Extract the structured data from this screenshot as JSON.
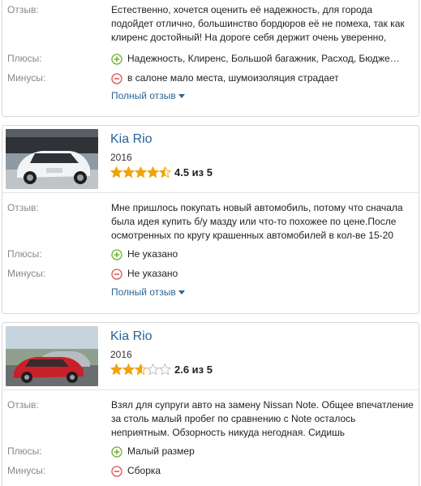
{
  "labels": {
    "review": "Отзыв:",
    "pros": "Плюсы:",
    "cons": "Минусы:",
    "more": "Полный отзыв"
  },
  "cards": [
    {
      "review": "Естественно, хочется оценить её надежность, для города подойдет отлично, большинство бордюров её не помеха, так как клиренс достойный! На дороге себя держит очень уверенно,",
      "pros": "Надежность, Клиренс, Большой багажник, Расход, Бюдже…",
      "cons": "в салоне мало места, шумоизоляция страдает"
    },
    {
      "title": "Kia Rio",
      "year": "2016",
      "rating": 4.5,
      "rating_text": "4.5 из 5",
      "photo_icon": "car-photo-white-hatchback",
      "review": "Мне пришлось покупать новый автомобиль, потому что сначала была идея купить б/у мазду или что-то похожее по цене.После осмотренных по кругу крашенных автомобилей в кол-ве 15-20",
      "pros": "Не указано",
      "cons": "Не указано"
    },
    {
      "title": "Kia Rio",
      "year": "2016",
      "rating": 2.6,
      "rating_text": "2.6 из 5",
      "photo_icon": "car-photo-red-sedan",
      "review": "Взял для супруги авто на замену Nissan Note. Общее впечатление за столь малый пробег по сравнению с Note осталось неприятным. Обзорность никуда негодная. Сидишь",
      "pros": "Малый размер",
      "cons": "Сборка"
    }
  ],
  "colors": {
    "link": "#2a6496",
    "star": "#f0a30a",
    "plus": "#6cb22a",
    "minus": "#d9534f",
    "label": "#888888"
  }
}
